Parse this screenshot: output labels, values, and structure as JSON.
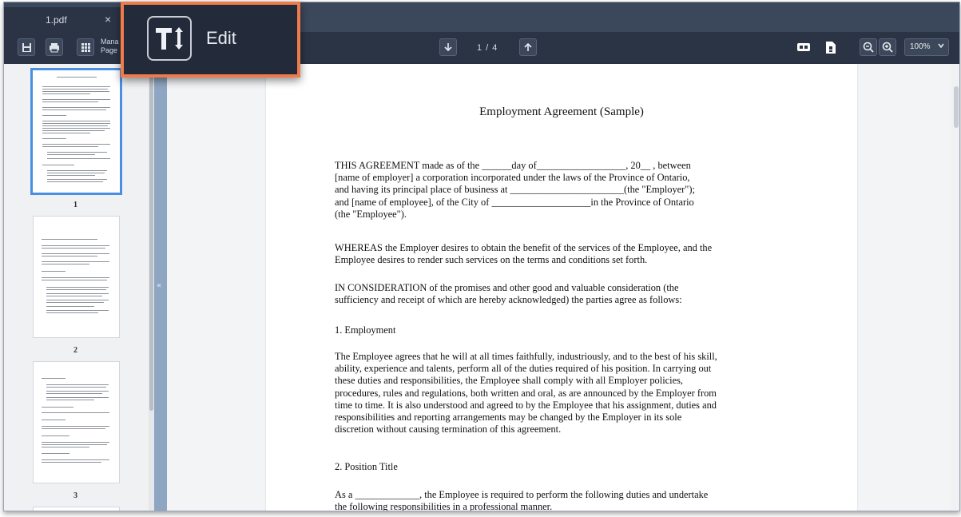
{
  "tab": {
    "title": "1.pdf",
    "close_glyph": "×"
  },
  "toolbar": {
    "manage_label_line1": "Mana",
    "manage_label_line2": "Page",
    "page_indicator": "1 / 4",
    "zoom_value": "100%",
    "icons": [
      "save-icon",
      "print-icon",
      "manage-pages-icon",
      "page-down-icon",
      "page-up-icon",
      "single-page-view-icon",
      "page-info-icon",
      "zoom-out-icon",
      "zoom-in-icon",
      "chevron-down-icon"
    ]
  },
  "edit_callout": {
    "label": "Edit",
    "icon": "text-edit-icon"
  },
  "sidebar": {
    "thumbnails": [
      {
        "page": "1"
      },
      {
        "page": "2"
      },
      {
        "page": "3"
      }
    ]
  },
  "document": {
    "title": "Employment Agreement (Sample)",
    "paragraphs": [
      "THIS AGREEMENT made as of the ______day of__________________, 20__ , between\n[name of employer] a corporation incorporated under the laws of the Province of Ontario,\nand having its principal place of business at _______________________(the \"Employer\");\nand [name of employee], of the City of ____________________in the Province of Ontario\n(the \"Employee\").",
      "WHEREAS the Employer desires to obtain the benefit of the services of the Employee, and the\nEmployee desires to render such services on the terms and conditions set forth.",
      "IN CONSIDERATION of the promises and other good and valuable consideration (the\nsufficiency and receipt of which are hereby acknowledged) the parties agree as follows:",
      "1. Employment",
      "The Employee agrees that he will at all times faithfully, industriously, and to the best of his skill,\nability, experience and talents, perform all of the duties required of his position. In carrying out\nthese duties and responsibilities, the Employee shall comply with all Employer policies,\nprocedures, rules and regulations, both written and oral, as are announced by the Employer from\ntime to time. It is also understood and agreed to by the Employee that his assignment, duties and\nresponsibilities and reporting arrangements may be changed by the Employer in its sole\ndiscretion without causing termination of this agreement.",
      "2. Position Title",
      "As a _____________, the Employee is required to perform the following duties and undertake\nthe following responsibilities in a professional manner."
    ]
  }
}
